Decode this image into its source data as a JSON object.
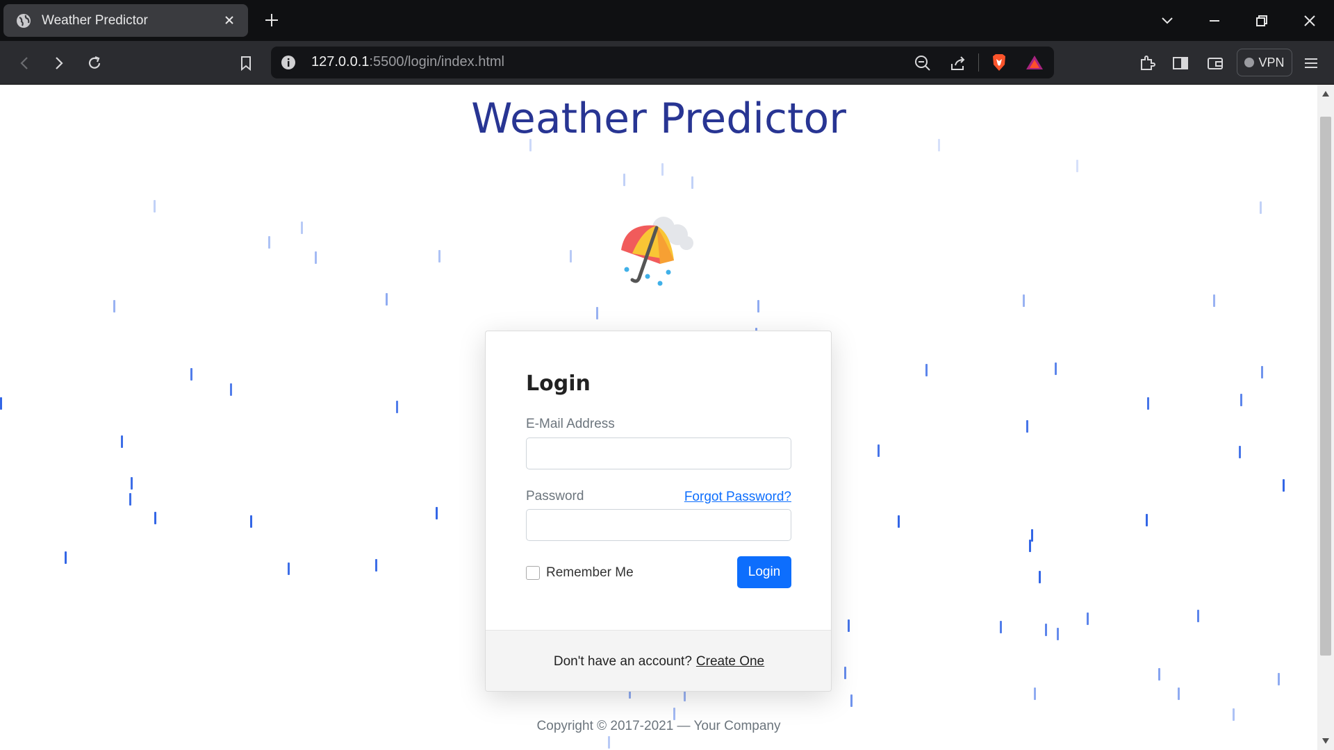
{
  "browser": {
    "tab_title": "Weather Predictor",
    "url_host": "127.0.0.1",
    "url_rest": ":5500/login/index.html",
    "vpn_label": "VPN"
  },
  "page": {
    "title": "Weather Predictor",
    "emoji": "umbrella-with-rain-cloud",
    "login": {
      "heading": "Login",
      "email_label": "E-Mail Address",
      "email_value": "",
      "password_label": "Password",
      "password_value": "",
      "forgot_link": "Forgot Password?",
      "remember_label": "Remember Me",
      "remember_checked": false,
      "login_button": "Login",
      "footer_text": "Don't have an account?",
      "create_link": "Create One"
    },
    "copyright": "Copyright © 2017-2021 — Your Company"
  },
  "colors": {
    "title": "#283593",
    "accent": "#0d6efd",
    "rain": "#3366e6"
  }
}
